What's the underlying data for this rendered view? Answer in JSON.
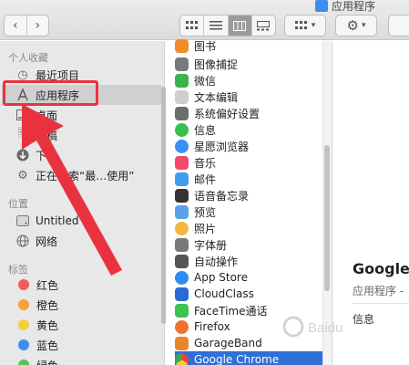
{
  "window": {
    "title": "应用程序"
  },
  "toolbar": {
    "back_icon": "chevron-left-icon",
    "forward_icon": "chevron-right-icon",
    "views": [
      "icon-view",
      "list-view",
      "column-view",
      "gallery-view"
    ],
    "active_view": "column-view"
  },
  "sidebar": {
    "favorites_header": "个人收藏",
    "favorites": [
      {
        "label": "最近项目",
        "icon": "clock-icon",
        "selected": false
      },
      {
        "label": "应用程序",
        "icon": "applications-icon",
        "selected": true
      },
      {
        "label": "桌面",
        "icon": "desktop-icon",
        "selected": false
      },
      {
        "label": "文稿",
        "icon": "documents-icon",
        "selected": false
      },
      {
        "label": "下载",
        "icon": "downloads-icon",
        "selected": false
      },
      {
        "label": "正在搜索“最…使用”",
        "icon": "gear-icon",
        "selected": false
      }
    ],
    "locations_header": "位置",
    "locations": [
      {
        "label": "Untitled",
        "icon": "disk-icon"
      },
      {
        "label": "网络",
        "icon": "globe-icon"
      }
    ],
    "tags_header": "标签",
    "tags": [
      {
        "label": "红色",
        "color": "#f35b57"
      },
      {
        "label": "橙色",
        "color": "#f5a33a"
      },
      {
        "label": "黄色",
        "color": "#f4cf3c"
      },
      {
        "label": "蓝色",
        "color": "#3d8ef0"
      },
      {
        "label": "绿色",
        "color": "#5ac05a"
      }
    ],
    "highlight_color": "#e8333f"
  },
  "app_list": [
    {
      "label": "图书",
      "color": "#f08c2c"
    },
    {
      "label": "图像捕捉",
      "color": "#7a7a7a"
    },
    {
      "label": "微信",
      "color": "#3cb34a"
    },
    {
      "label": "文本编辑",
      "color": "#cfcfcf"
    },
    {
      "label": "系统偏好设置",
      "color": "#6c6c6c"
    },
    {
      "label": "信息",
      "color": "#35c24f"
    },
    {
      "label": "星愿浏览器",
      "color": "#3a8ff2"
    },
    {
      "label": "音乐",
      "color": "#f04a6a"
    },
    {
      "label": "邮件",
      "color": "#3f9cf0"
    },
    {
      "label": "语音备忘录",
      "color": "#333333"
    },
    {
      "label": "预览",
      "color": "#5aa2e8"
    },
    {
      "label": "照片",
      "color": "#f2b73e"
    },
    {
      "label": "字体册",
      "color": "#7a7a7a"
    },
    {
      "label": "自动操作",
      "color": "#555555"
    },
    {
      "label": "App Store",
      "color": "#2f8bf0"
    },
    {
      "label": "CloudClass",
      "color": "#2a6ad6"
    },
    {
      "label": "FaceTime通话",
      "color": "#3ec24f"
    },
    {
      "label": "Firefox",
      "color": "#f0712c"
    },
    {
      "label": "GarageBand",
      "color": "#e8852c"
    },
    {
      "label": "Google Chrome",
      "color": "#e8453c"
    }
  ],
  "selected_app": "Google Chrome",
  "preview": {
    "name": "Google C",
    "kind": "应用程序 -",
    "more": "信息"
  }
}
